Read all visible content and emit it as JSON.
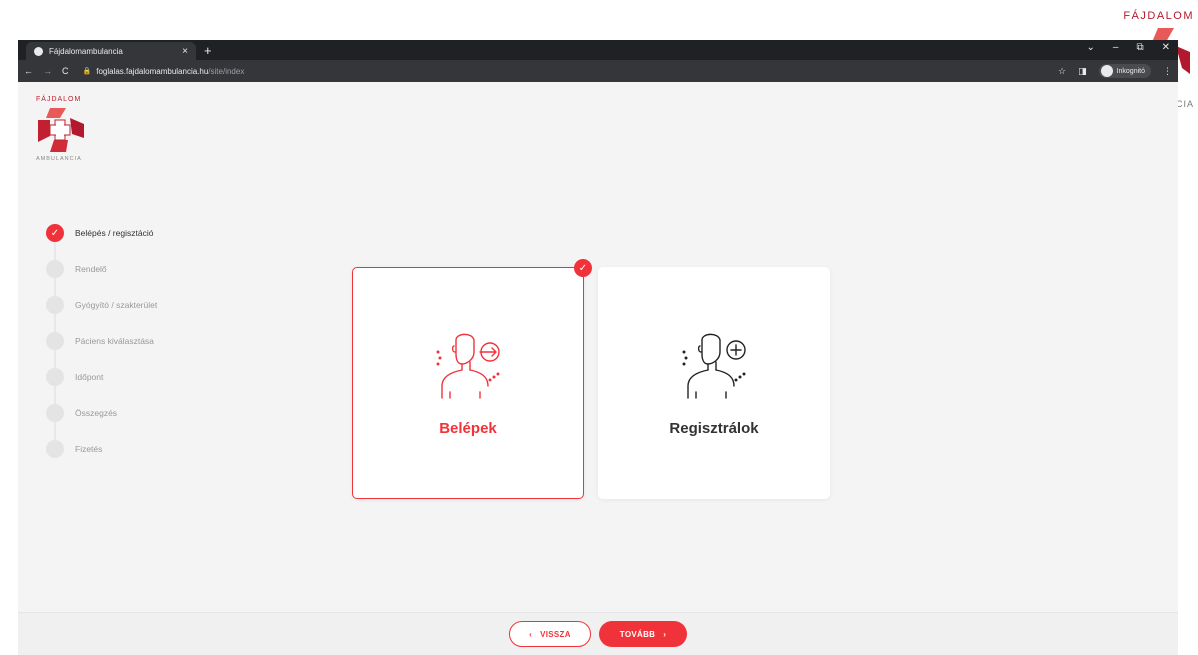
{
  "background_logo": {
    "top_text": "FÁJDALOM",
    "bottom_text": "CIA"
  },
  "browser": {
    "tab_title": "Fájdalomambulancia",
    "tab_close": "×",
    "new_tab": "+",
    "window_controls": [
      "⌄",
      "–",
      "⧉",
      "✕"
    ],
    "url_host": "foglalas.fajdalomambulancia.hu",
    "url_path": "/site/index",
    "incognito_label": "Inkognitó"
  },
  "site": {
    "logo_top": "FÁJDALOM",
    "logo_bottom": "AMBULANCIA",
    "steps": [
      {
        "label": "Belépés / regisztáció",
        "done": true
      },
      {
        "label": "Rendelő",
        "done": false
      },
      {
        "label": "Gyógyító / szakterület",
        "done": false
      },
      {
        "label": "Páciens kiválasztása",
        "done": false
      },
      {
        "label": "Időpont",
        "done": false
      },
      {
        "label": "Összegzés",
        "done": false
      },
      {
        "label": "Fizetés",
        "done": false
      }
    ],
    "cards": [
      {
        "title": "Belépek",
        "selected": true,
        "icon": "person-login-icon"
      },
      {
        "title": "Regisztrálok",
        "selected": false,
        "icon": "person-add-icon"
      }
    ],
    "footer": {
      "back_label": "VISSZA",
      "next_label": "TOVÁBB"
    }
  },
  "colors": {
    "accent": "#f0333a",
    "logo_red": "#c0202f"
  }
}
